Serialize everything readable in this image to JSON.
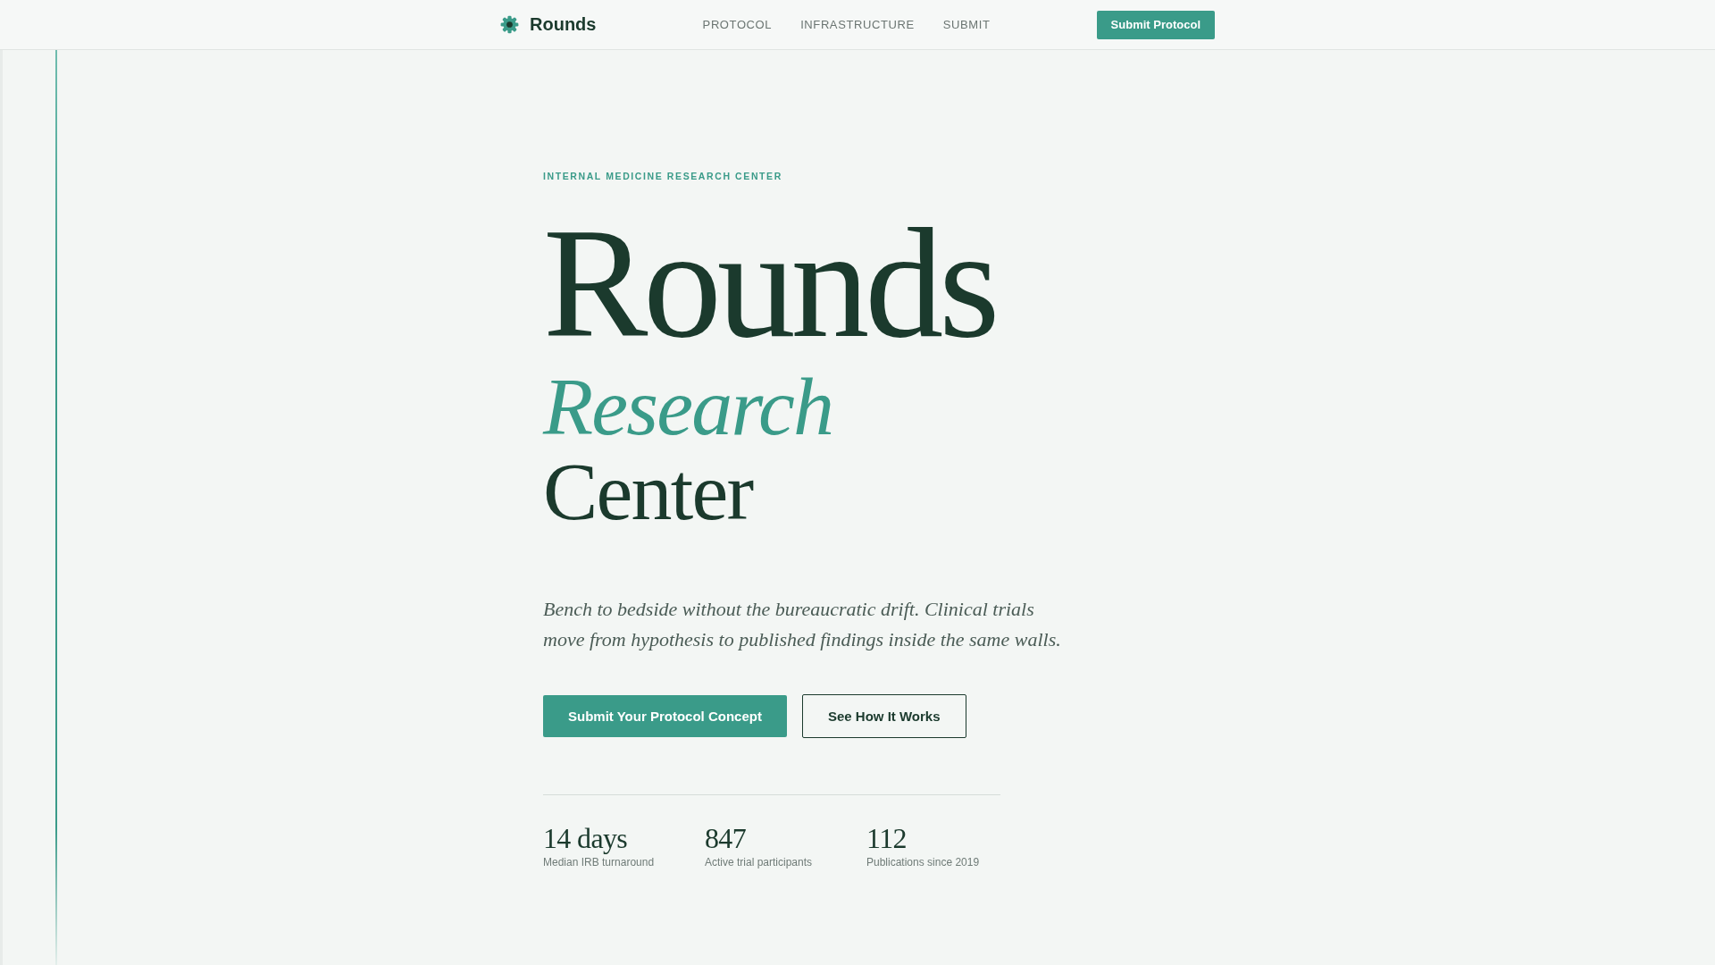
{
  "header": {
    "brand": "Rounds",
    "nav": [
      "PROTOCOL",
      "INFRASTRUCTURE",
      "SUBMIT"
    ],
    "cta": "Submit Protocol"
  },
  "hero": {
    "eyebrow": "INTERNAL MEDICINE RESEARCH CENTER",
    "title": "Rounds",
    "subtitle": "*Research* Center",
    "lead": "Bench to bedside without the bureaucratic drift. Clinical trials move from hypothesis to published findings inside the same walls.",
    "buttons": [
      {
        "label": "Submit Your Protocol Concept",
        "kind": "primary"
      },
      {
        "label": "See How It Works",
        "kind": "outline"
      }
    ]
  },
  "stats": [
    {
      "value": "14 days",
      "label": "Median IRB turnaround"
    },
    {
      "value": "847",
      "label": "Active trial participants"
    },
    {
      "value": "112",
      "label": "Publications since 2019"
    }
  ]
}
